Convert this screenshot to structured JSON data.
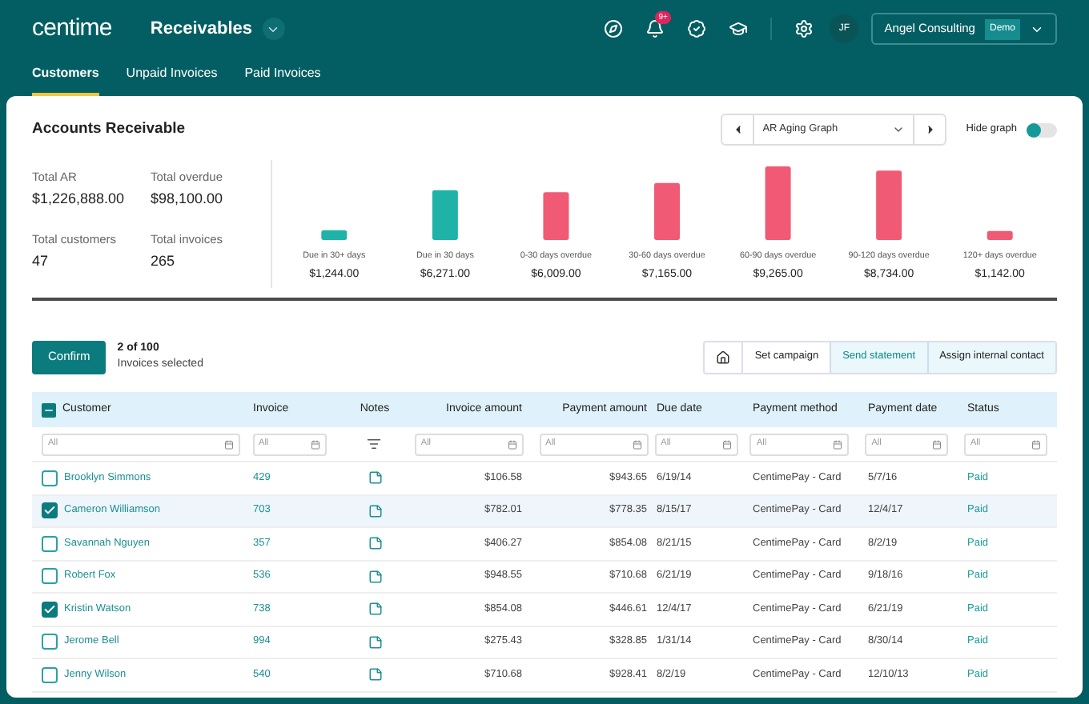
{
  "header": {
    "logo": "centime",
    "module": "Receivables",
    "notification_badge": "9+",
    "avatar": "JF",
    "account": "Angel Consulting",
    "account_badge": "Demo"
  },
  "tabs": [
    {
      "label": "Customers",
      "selected": true
    },
    {
      "label": "Unpaid Invoices",
      "selected": false
    },
    {
      "label": "Paid Invoices",
      "selected": false
    }
  ],
  "card": {
    "title": "Accounts Receivable",
    "graph_select": "AR Aging Graph",
    "hide_graph": {
      "label": "Hide graph",
      "on": false
    }
  },
  "stats": [
    {
      "label": "Total AR",
      "value": "$1,226,888.00"
    },
    {
      "label": "Total overdue",
      "value": "$98,100.00"
    },
    {
      "label": "Total customers",
      "value": "47"
    },
    {
      "label": "Total invoices",
      "value": "265"
    }
  ],
  "chart_data": {
    "type": "bar",
    "categories": [
      "Due in 30+ days",
      "Due in 30 days",
      "0-30 days overdue",
      "30-60 days overdue",
      "60-90 days overdue",
      "90-120 days overdue",
      "120+ days overdue"
    ],
    "values": [
      1244,
      6271,
      6009,
      7165,
      9265,
      8734,
      1142
    ],
    "value_labels": [
      "$1,244.00",
      "$6,271.00",
      "$6,009.00",
      "$7,165.00",
      "$9,265.00",
      "$8,734.00",
      "$1,142.00"
    ],
    "colors": [
      "#1fb3a8",
      "#1fb3a8",
      "#f05a74",
      "#f05a74",
      "#f05a74",
      "#f05a74",
      "#f05a74"
    ]
  },
  "selection": {
    "confirm": "Confirm",
    "count": "2 of 100",
    "caption": "Invoices selected"
  },
  "actions": [
    {
      "label": "Set campaign",
      "kind": "plain"
    },
    {
      "label": "Send statement",
      "kind": "accent"
    },
    {
      "label": "Assign internal contact",
      "kind": "tinted"
    }
  ],
  "table": {
    "select_all": {
      "indeterminate": true
    },
    "columns": [
      "Customer",
      "Invoice",
      "Notes",
      "Invoice amount",
      "Payment amount",
      "Due date",
      "Payment method",
      "Payment date",
      "Status"
    ],
    "filters": [
      {
        "kind": "field",
        "placeholder": "All"
      },
      {
        "kind": "field",
        "placeholder": "All"
      },
      {
        "kind": "icon"
      },
      {
        "kind": "field",
        "placeholder": "All"
      },
      {
        "kind": "field",
        "placeholder": "All"
      },
      {
        "kind": "field",
        "placeholder": "All"
      },
      {
        "kind": "field",
        "placeholder": "All"
      },
      {
        "kind": "field",
        "placeholder": "All"
      },
      {
        "kind": "field",
        "placeholder": "All"
      }
    ],
    "rows": [
      {
        "checked": false,
        "selected": false,
        "customer": "Brooklyn Simmons",
        "invoice": "429",
        "invoice_amount": "$106.58",
        "payment_amount": "$943.65",
        "due_date": "6/19/14",
        "payment_method": "CentimePay - Card",
        "payment_date": "5/7/16",
        "status": "Paid"
      },
      {
        "checked": true,
        "selected": true,
        "customer": "Cameron Williamson",
        "invoice": "703",
        "invoice_amount": "$782.01",
        "payment_amount": "$778.35",
        "due_date": "8/15/17",
        "payment_method": "CentimePay - Card",
        "payment_date": "12/4/17",
        "status": "Paid"
      },
      {
        "checked": false,
        "selected": false,
        "customer": "Savannah Nguyen",
        "invoice": "357",
        "invoice_amount": "$406.27",
        "payment_amount": "$854.08",
        "due_date": "8/21/15",
        "payment_method": "CentimePay - Card",
        "payment_date": "8/2/19",
        "status": "Paid"
      },
      {
        "checked": false,
        "selected": false,
        "customer": "Robert Fox",
        "invoice": "536",
        "invoice_amount": "$948.55",
        "payment_amount": "$710.68",
        "due_date": "6/21/19",
        "payment_method": "CentimePay - Card",
        "payment_date": "9/18/16",
        "status": "Paid"
      },
      {
        "checked": true,
        "selected": false,
        "customer": "Kristin Watson",
        "invoice": "738",
        "invoice_amount": "$854.08",
        "payment_amount": "$446.61",
        "due_date": "12/4/17",
        "payment_method": "CentimePay - Card",
        "payment_date": "6/21/19",
        "status": "Paid"
      },
      {
        "checked": false,
        "selected": false,
        "customer": "Jerome Bell",
        "invoice": "994",
        "invoice_amount": "$275.43",
        "payment_amount": "$328.85",
        "due_date": "1/31/14",
        "payment_method": "CentimePay - Card",
        "payment_date": "8/30/14",
        "status": "Paid"
      },
      {
        "checked": false,
        "selected": false,
        "customer": "Jenny Wilson",
        "invoice": "540",
        "invoice_amount": "$710.68",
        "payment_amount": "$928.41",
        "due_date": "8/2/19",
        "payment_method": "CentimePay - Card",
        "payment_date": "12/10/13",
        "status": "Paid"
      }
    ]
  }
}
